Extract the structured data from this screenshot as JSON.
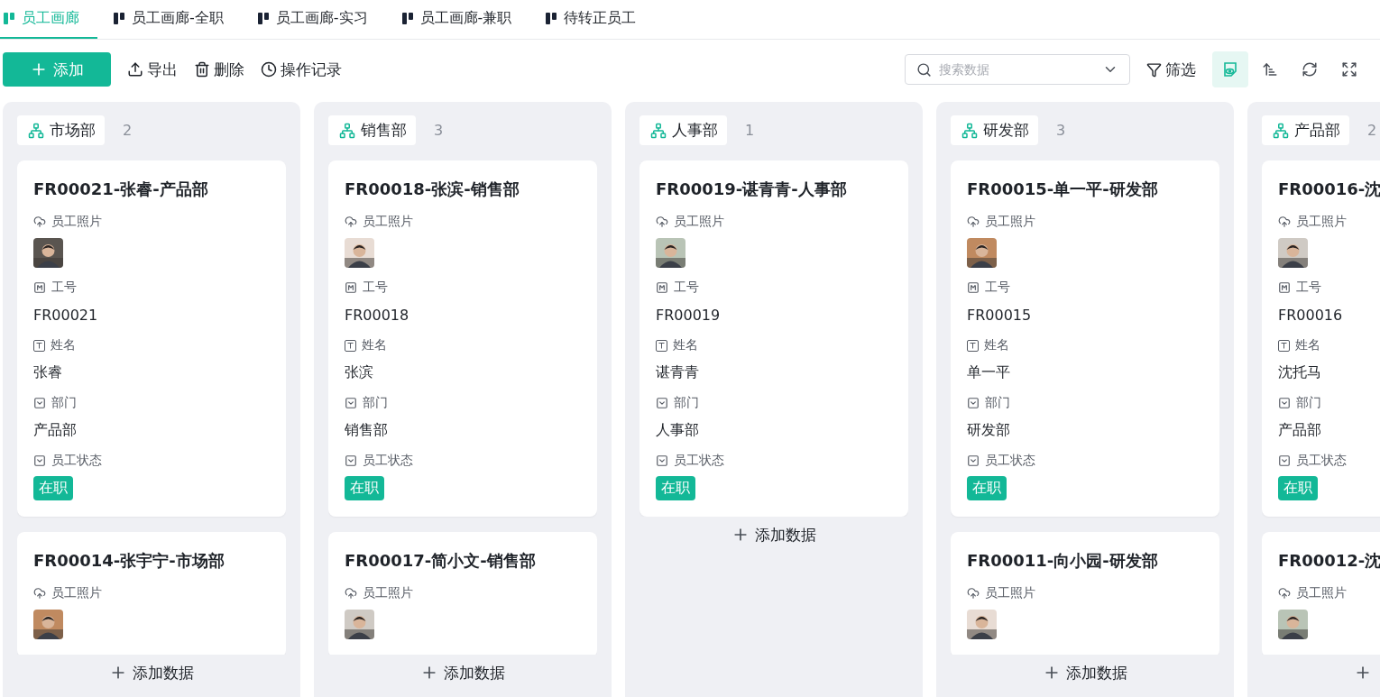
{
  "tabs": [
    {
      "label": "员工画廊",
      "selected": true
    },
    {
      "label": "员工画廊-全职",
      "selected": false
    },
    {
      "label": "员工画廊-实习",
      "selected": false
    },
    {
      "label": "员工画廊-兼职",
      "selected": false
    },
    {
      "label": "待转正员工",
      "selected": false
    }
  ],
  "toolbar": {
    "add_button": "添加",
    "actions": [
      {
        "kind": "export",
        "label": "导出"
      },
      {
        "kind": "delete",
        "label": "删除"
      },
      {
        "kind": "history",
        "label": "操作记录"
      }
    ],
    "search": {
      "placeholder": "搜索数据"
    },
    "filter": "筛选",
    "tools": [
      {
        "kind": "view",
        "selected": true
      },
      {
        "kind": "sort",
        "selected": false
      },
      {
        "kind": "refresh",
        "selected": false
      },
      {
        "kind": "fullscreen",
        "selected": false
      }
    ]
  },
  "columns": [
    {
      "name": "市场部",
      "count": "2",
      "add_label": "添加数据",
      "cards": [
        {
          "title": "FR00021-张睿-产品部",
          "fields": [
            {
              "label": "员工照片"
            },
            {
              "kind": "number",
              "label": "工号",
              "value": "FR00021"
            },
            {
              "kind": "text",
              "label": "姓名",
              "value": "张睿"
            },
            {
              "kind": "select",
              "label": "部门",
              "value": "产品部"
            },
            {
              "kind": "status",
              "label": "员工状态",
              "value": "在职"
            }
          ]
        },
        {
          "title": "FR00014-张宇宁-市场部",
          "fields": [
            {
              "label": "员工照片"
            }
          ]
        }
      ]
    },
    {
      "name": "销售部",
      "count": "3",
      "add_label": "添加数据",
      "cards": [
        {
          "title": "FR00018-张滨-销售部",
          "fields": [
            {
              "label": "员工照片"
            },
            {
              "kind": "number",
              "label": "工号",
              "value": "FR00018"
            },
            {
              "kind": "text",
              "label": "姓名",
              "value": "张滨"
            },
            {
              "kind": "select",
              "label": "部门",
              "value": "销售部"
            },
            {
              "kind": "status",
              "label": "员工状态",
              "value": "在职"
            }
          ]
        },
        {
          "title": "FR00017-简小文-销售部",
          "fields": [
            {
              "label": "员工照片"
            }
          ]
        }
      ]
    },
    {
      "name": "人事部",
      "count": "1",
      "add_label": "添加数据",
      "cards": [
        {
          "title": "FR00019-谌青青-人事部",
          "fields": [
            {
              "label": "员工照片"
            },
            {
              "kind": "number",
              "label": "工号",
              "value": "FR00019"
            },
            {
              "kind": "text",
              "label": "姓名",
              "value": "谌青青"
            },
            {
              "kind": "select",
              "label": "部门",
              "value": "人事部"
            },
            {
              "kind": "status",
              "label": "员工状态",
              "value": "在职"
            }
          ]
        }
      ]
    },
    {
      "name": "研发部",
      "count": "3",
      "add_label": "添加数据",
      "cards": [
        {
          "title": "FR00015-单一平-研发部",
          "fields": [
            {
              "label": "员工照片"
            },
            {
              "kind": "number",
              "label": "工号",
              "value": "FR00015"
            },
            {
              "kind": "text",
              "label": "姓名",
              "value": "单一平"
            },
            {
              "kind": "select",
              "label": "部门",
              "value": "研发部"
            },
            {
              "kind": "status",
              "label": "员工状态",
              "value": "在职"
            }
          ]
        },
        {
          "title": "FR00011-向小园-研发部",
          "fields": [
            {
              "label": "员工照片"
            }
          ]
        }
      ]
    },
    {
      "name": "产品部",
      "count": "2",
      "cards": [
        {
          "title": "FR00016-沈",
          "fields": [
            {
              "label": "员工照片"
            },
            {
              "kind": "number",
              "label": "工号",
              "value": "FR00016"
            },
            {
              "kind": "text",
              "label": "姓名",
              "value": "沈托马"
            },
            {
              "kind": "select",
              "label": "部门",
              "value": "产品部"
            },
            {
              "kind": "status",
              "label": "员工状态",
              "value": "在职"
            }
          ]
        },
        {
          "title": "FR00012-沈",
          "fields": [
            {
              "label": "员工照片"
            }
          ]
        }
      ]
    }
  ]
}
